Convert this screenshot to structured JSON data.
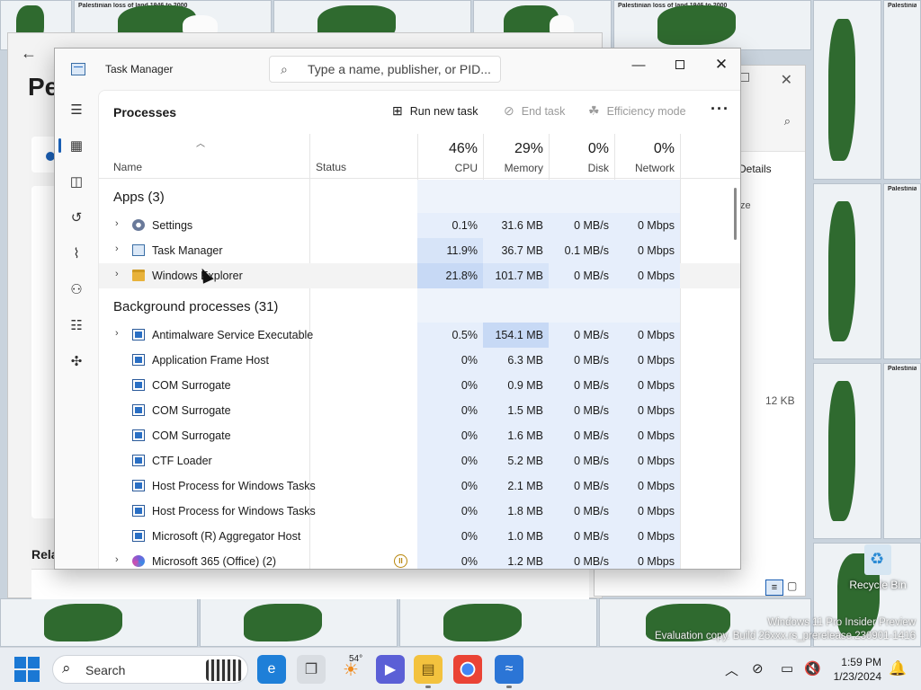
{
  "wallpaper": {
    "caption": "Palestinian loss of land 1946 to 2000",
    "caption_short": "Palestinian"
  },
  "settings_window": {
    "title_fragment": "Pe",
    "section_related": "Rela"
  },
  "explorer_window": {
    "details_label": "Details",
    "column_fragment": "ze",
    "file_size": "12 KB"
  },
  "task_manager": {
    "title": "Task Manager",
    "search_placeholder": "Type a name, publisher, or PID...",
    "page_title": "Processes",
    "commands": {
      "run_new_task": "Run new task",
      "end_task": "End task",
      "efficiency_mode": "Efficiency mode"
    },
    "columns": {
      "name": "Name",
      "status": "Status",
      "cpu_pct": "46%",
      "cpu": "CPU",
      "memory_pct": "29%",
      "memory": "Memory",
      "disk_pct": "0%",
      "disk": "Disk",
      "network_pct": "0%",
      "network": "Network"
    },
    "groups": {
      "apps": "Apps (3)",
      "background": "Background processes (31)"
    },
    "apps": [
      {
        "name": "Settings",
        "cpu": "0.1%",
        "memory": "31.6 MB",
        "disk": "0 MB/s",
        "network": "0 Mbps"
      },
      {
        "name": "Task Manager",
        "cpu": "11.9%",
        "memory": "36.7 MB",
        "disk": "0.1 MB/s",
        "network": "0 Mbps"
      },
      {
        "name": "Windows Explorer",
        "cpu": "21.8%",
        "memory": "101.7 MB",
        "disk": "0 MB/s",
        "network": "0 Mbps"
      }
    ],
    "background": [
      {
        "name": "Antimalware Service Executable",
        "cpu": "0.5%",
        "memory": "154.1 MB",
        "disk": "0 MB/s",
        "network": "0 Mbps"
      },
      {
        "name": "Application Frame Host",
        "cpu": "0%",
        "memory": "6.3 MB",
        "disk": "0 MB/s",
        "network": "0 Mbps"
      },
      {
        "name": "COM Surrogate",
        "cpu": "0%",
        "memory": "0.9 MB",
        "disk": "0 MB/s",
        "network": "0 Mbps"
      },
      {
        "name": "COM Surrogate",
        "cpu": "0%",
        "memory": "1.5 MB",
        "disk": "0 MB/s",
        "network": "0 Mbps"
      },
      {
        "name": "COM Surrogate",
        "cpu": "0%",
        "memory": "1.6 MB",
        "disk": "0 MB/s",
        "network": "0 Mbps"
      },
      {
        "name": "CTF Loader",
        "cpu": "0%",
        "memory": "5.2 MB",
        "disk": "0 MB/s",
        "network": "0 Mbps"
      },
      {
        "name": "Host Process for Windows Tasks",
        "cpu": "0%",
        "memory": "2.1 MB",
        "disk": "0 MB/s",
        "network": "0 Mbps"
      },
      {
        "name": "Host Process for Windows Tasks",
        "cpu": "0%",
        "memory": "1.8 MB",
        "disk": "0 MB/s",
        "network": "0 Mbps"
      },
      {
        "name": "Microsoft (R) Aggregator Host",
        "cpu": "0%",
        "memory": "1.0 MB",
        "disk": "0 MB/s",
        "network": "0 Mbps"
      },
      {
        "name": "Microsoft 365 (Office) (2)",
        "cpu": "0%",
        "memory": "1.2 MB",
        "disk": "0 MB/s",
        "network": "0 Mbps"
      }
    ]
  },
  "desktop": {
    "recycle_bin": "Recycle Bin",
    "watermark_line1": "Windows 11 Pro Insider Preview",
    "watermark_line2": "Evaluation copy. Build 26xxx.rs_prerelease.230901-1416"
  },
  "taskbar": {
    "search_label": "Search",
    "weather_temp": "54°",
    "time": "1:59 PM",
    "date": "1/23/2024"
  },
  "colors": {
    "accent": "#1a5fb4",
    "heat_light": "#e6eefb",
    "heat_mid": "#d7e4f8",
    "heat_strong": "#c7d9f5"
  }
}
